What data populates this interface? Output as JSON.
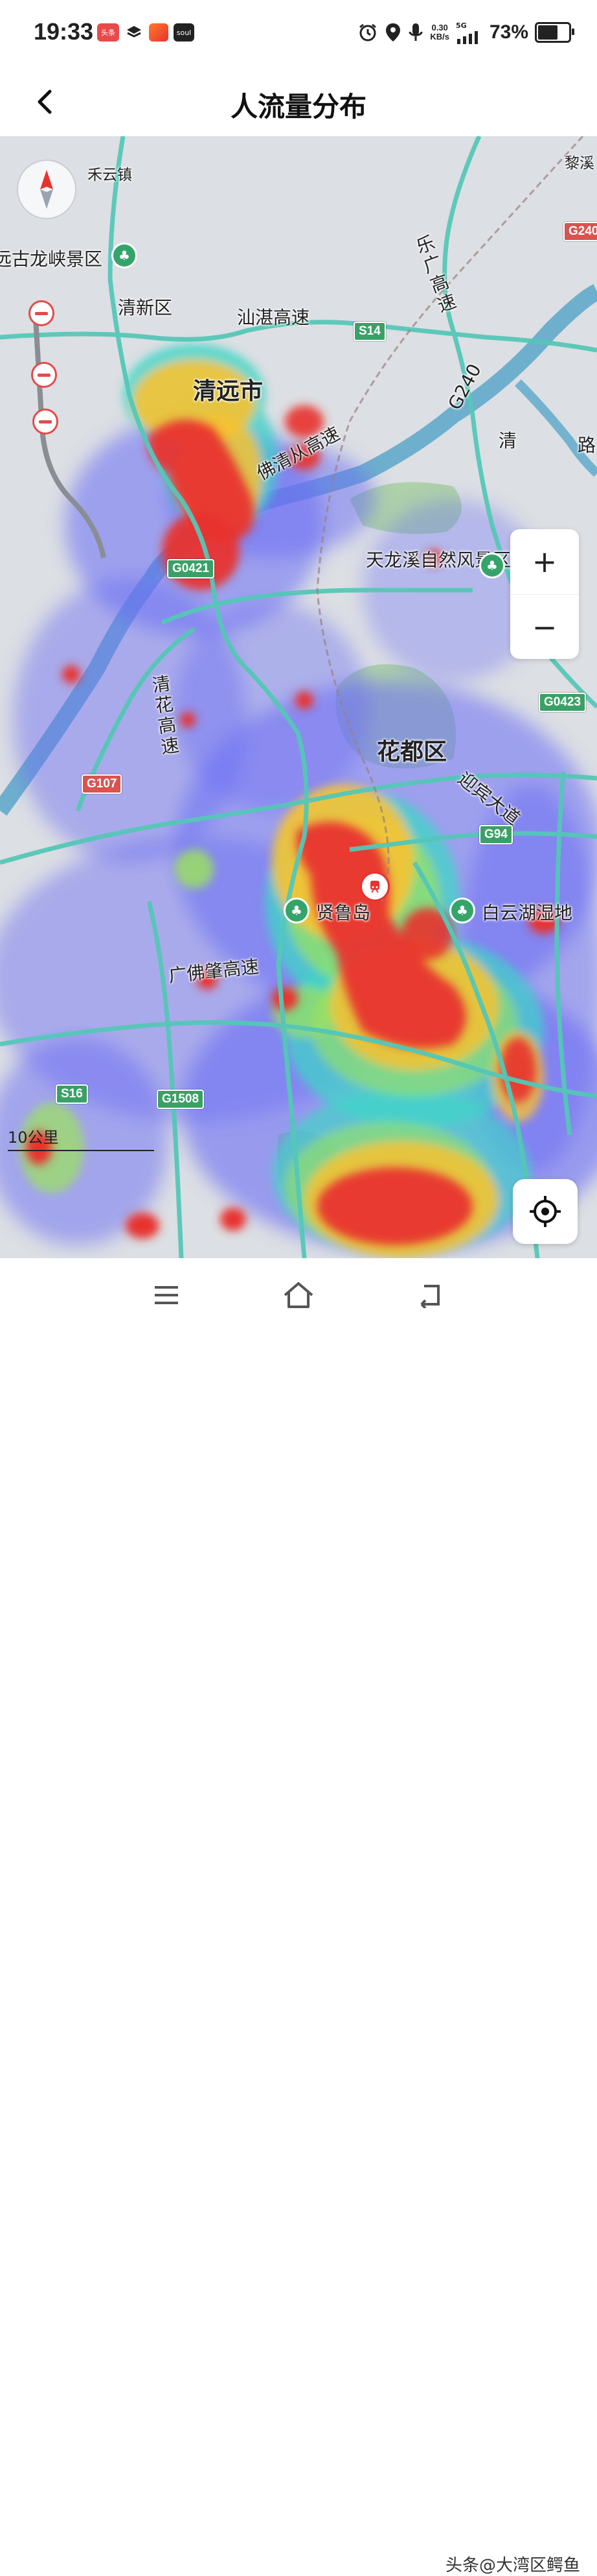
{
  "status_bar": {
    "time": "19:33",
    "apps": [
      "头条",
      "soul"
    ],
    "net_speed_value": "0.30",
    "net_speed_unit": "KB/s",
    "signal_label": "5G",
    "battery_percent": "73%",
    "battery_level": 0.73
  },
  "header": {
    "title": "人流量分布"
  },
  "map": {
    "labels": {
      "heyun": "禾云镇",
      "gulong": "远古龙峡景区",
      "qingxin": "清新区",
      "shanzhan": "汕湛高速",
      "qingyuan": "清远市",
      "leguang": "乐广高速",
      "g240": "G240",
      "foqingcong": "佛清从高速",
      "tianlongxi": "天龙溪自然风景区",
      "qinghua": "清花高速",
      "huadu": "花都区",
      "yingbin": "迎宾大道",
      "xianludao": "贤鲁岛",
      "baiyun": "白云湖湿地",
      "lixi": "黎溪",
      "qing_road": "清",
      "lu": "路",
      "bottom_road": "广佛肇高速"
    },
    "shields": {
      "s14": "S14",
      "g0421": "G0421",
      "g0423": "G0423",
      "g107": "G107",
      "g94": "G94",
      "s16": "S16",
      "g1508": "G1508",
      "g240_top": "G240"
    },
    "zoom_in": "+",
    "zoom_out": "−",
    "scale_text": "10公里",
    "heatmap_colors": {
      "low": "#6a6cf5",
      "mid": "#3dd6c6",
      "mid2": "#9be35b",
      "high": "#f7c232",
      "peak": "#e8322f"
    },
    "icons": [
      "compass-icon",
      "zoom-in-icon",
      "zoom-out-icon",
      "locate-icon",
      "park-icon",
      "restriction-icon",
      "subway-icon"
    ]
  },
  "nav_bar": {
    "watermark": "头条@大湾区鳄鱼"
  }
}
